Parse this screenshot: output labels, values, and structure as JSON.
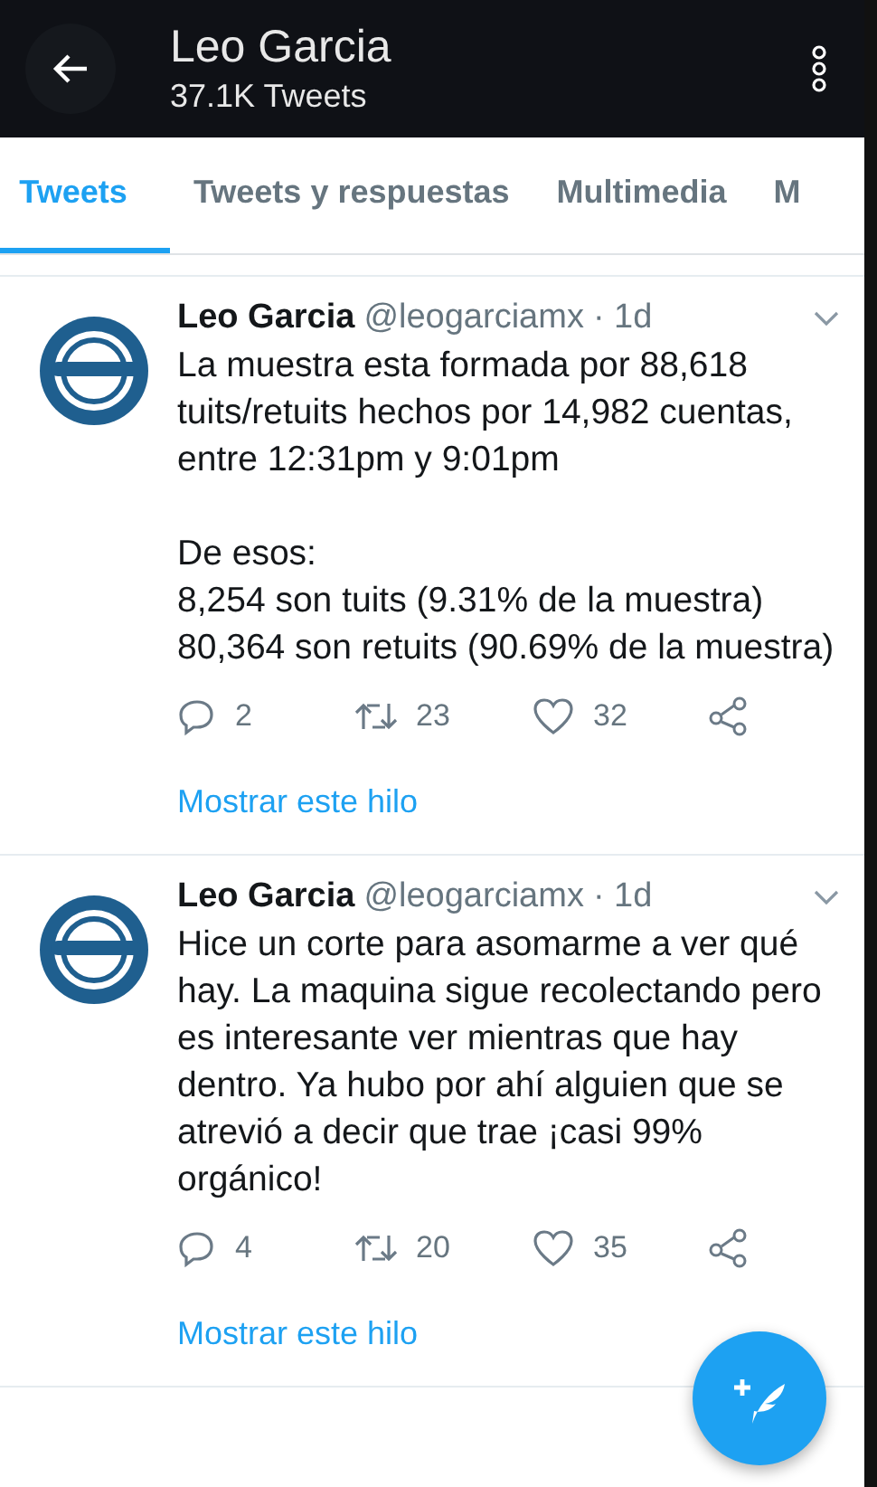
{
  "header": {
    "title": "Leo Garcia",
    "subtitle": "37.1K Tweets"
  },
  "tabs": [
    {
      "label": "Tweets",
      "selected": true
    },
    {
      "label": "Tweets y respuestas",
      "selected": false
    },
    {
      "label": "Multimedia",
      "selected": false
    },
    {
      "label": "M",
      "selected": false
    }
  ],
  "tweets": [
    {
      "name": "Leo Garcia",
      "handle": "@leogarciamx",
      "time": "· 1d",
      "text": "La muestra esta formada por 88,618 tuits/retuits hechos por 14,982 cuentas, entre 12:31pm y 9:01pm\n\nDe esos:\n8,254 son tuits (9.31% de la muestra)\n80,364 son retuits (90.69% de la muestra)",
      "replies": "2",
      "retweets": "23",
      "likes": "32",
      "thread_link": "Mostrar este hilo"
    },
    {
      "name": "Leo Garcia",
      "handle": "@leogarciamx",
      "time": "· 1d",
      "text": "Hice un corte para asomarme a ver qué hay. La maquina sigue recolectando pero es interesante ver mientras que hay dentro. Ya hubo por ahí alguien que se atrevió a decir que trae ¡casi 99% orgánico!",
      "replies": "4",
      "retweets": "20",
      "likes": "35",
      "thread_link": "Mostrar este hilo"
    }
  ]
}
